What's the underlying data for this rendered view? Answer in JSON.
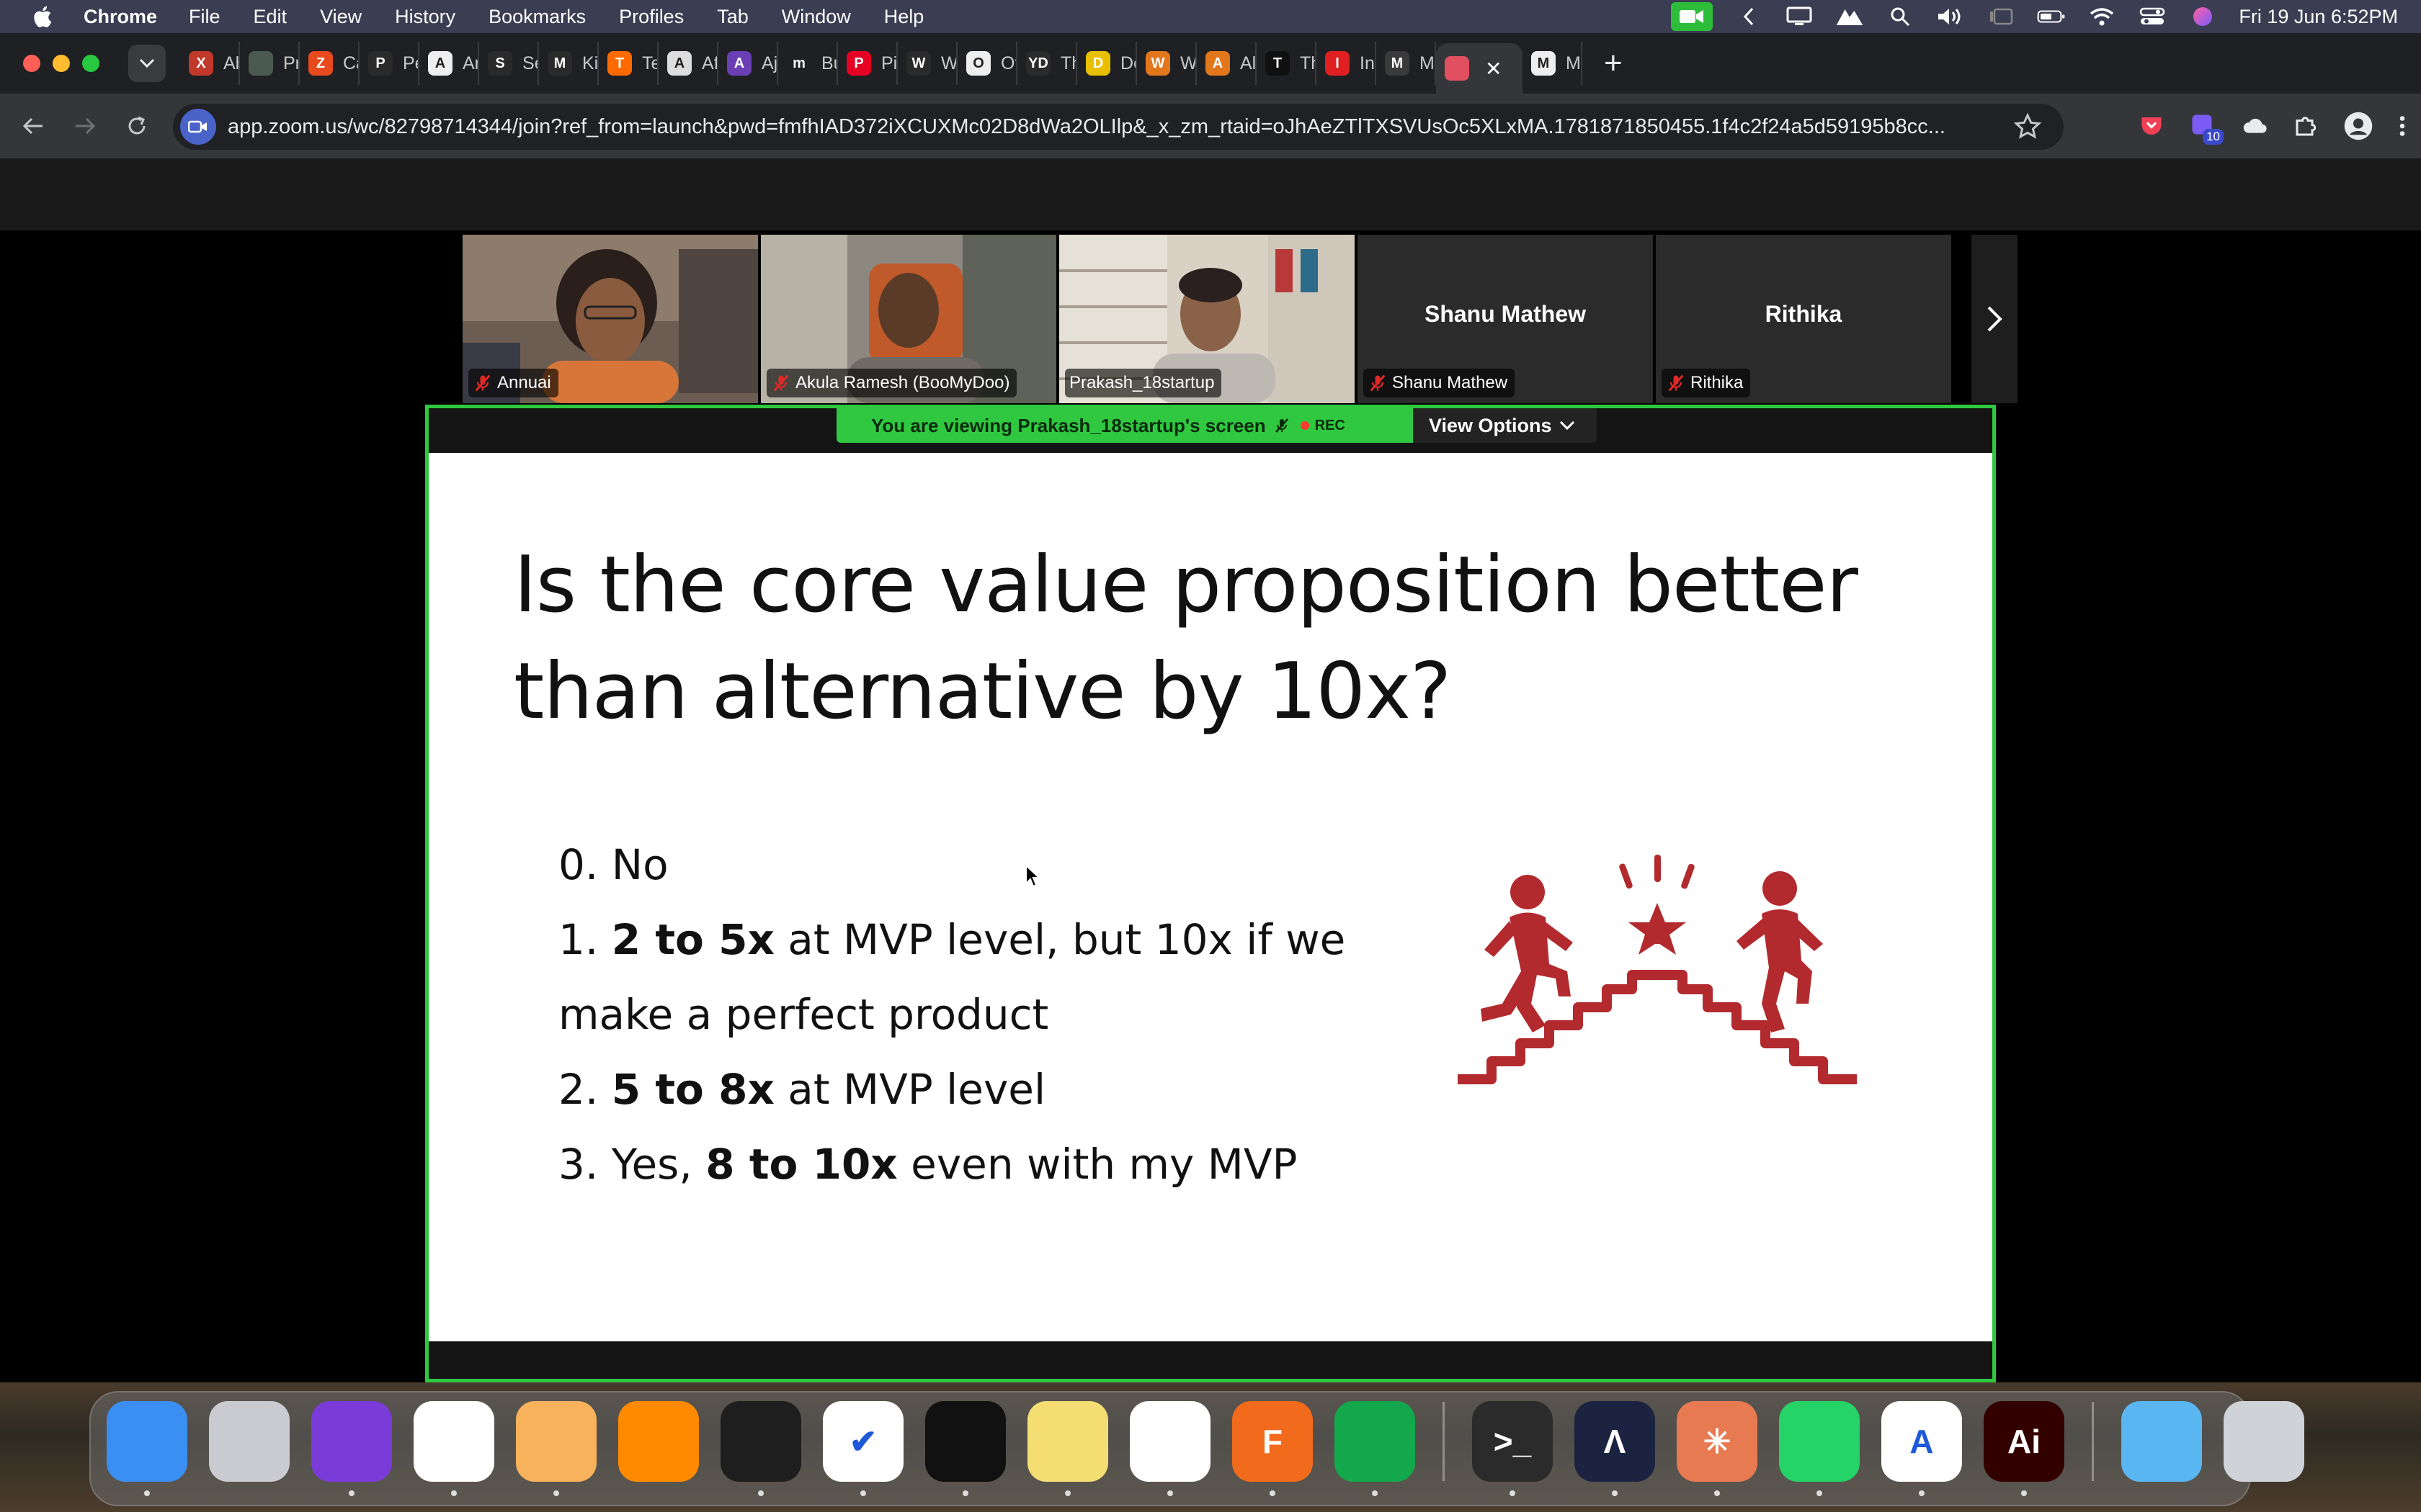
{
  "menubar": {
    "app_name": "Chrome",
    "items": [
      "File",
      "Edit",
      "View",
      "History",
      "Bookmarks",
      "Profiles",
      "Tab",
      "Window",
      "Help"
    ],
    "clock": "Fri 19 Jun  6:52PM"
  },
  "tabs": [
    {
      "label": "Ab",
      "color": "#c0392b",
      "glyph": "X"
    },
    {
      "label": "Pro",
      "color": "#4a5a50",
      "glyph": ""
    },
    {
      "label": "Cal",
      "color": "#e8491d",
      "glyph": "Z"
    },
    {
      "label": "Per",
      "color": "#2a2a2a",
      "glyph": "P"
    },
    {
      "label": "Arc",
      "color": "#eeeeee",
      "glyph": "A"
    },
    {
      "label": "Se",
      "color": "#2a2a2a",
      "glyph": "S"
    },
    {
      "label": "Kid",
      "color": "#2a2a2a",
      "glyph": "M"
    },
    {
      "label": "Ter",
      "color": "#ff6a00",
      "glyph": "T"
    },
    {
      "label": "Aff",
      "color": "#dddddd",
      "glyph": "A"
    },
    {
      "label": "Aja",
      "color": "#6a3fb5",
      "glyph": "A"
    },
    {
      "label": "Buy",
      "color": "#1f2023",
      "glyph": "m"
    },
    {
      "label": "Pin",
      "color": "#e60023",
      "glyph": "P"
    },
    {
      "label": "Wo",
      "color": "#2a2a2a",
      "glyph": "W"
    },
    {
      "label": "Off",
      "color": "#eeeeee",
      "glyph": "O"
    },
    {
      "label": "Thi",
      "color": "#2a2a2a",
      "glyph": "YD"
    },
    {
      "label": "De",
      "color": "#e8c000",
      "glyph": "D"
    },
    {
      "label": "Wo",
      "color": "#e2761b",
      "glyph": "W"
    },
    {
      "label": "All",
      "color": "#e2761b",
      "glyph": "A"
    },
    {
      "label": "The",
      "color": "#101010",
      "glyph": "T"
    },
    {
      "label": "In C",
      "color": "#e02020",
      "glyph": "I"
    },
    {
      "label": "Mo",
      "color": "#3a3a3a",
      "glyph": "M"
    },
    {
      "label": "",
      "color": "#e05060",
      "glyph": ""
    },
    {
      "label": "My",
      "color": "#eeeeee",
      "glyph": "M"
    }
  ],
  "address_bar": {
    "url": "app.zoom.us/wc/82798714344/join?ref_from=launch&pwd=fmfhIAD372iXCUXMc02D8dWa2OLIlp&_x_zm_rtaid=oJhAeZTlTXSVUsOc5XLxMA.1781871850455.1f4c2f24a5d59195b8cc..."
  },
  "toolbar": {
    "extension_badge": "10"
  },
  "participants": [
    {
      "name": "Annuai",
      "has_video": true,
      "muted": true,
      "speaking": false
    },
    {
      "name": "Akula Ramesh (BooMyDoo)",
      "has_video": true,
      "muted": true,
      "speaking": false
    },
    {
      "name": "Prakash_18startup",
      "has_video": true,
      "muted": false,
      "speaking": true
    },
    {
      "name": "Shanu Mathew",
      "has_video": false,
      "muted": true,
      "speaking": false
    },
    {
      "name": "Rithika",
      "has_video": false,
      "muted": true,
      "speaking": false
    }
  ],
  "share_banner": {
    "text": "You are viewing  Prakash_18startup's screen",
    "rec": "REC",
    "view_options": "View Options"
  },
  "slide": {
    "title": "Is the core value proposition better than alternative by 10x?",
    "options": [
      {
        "prefix": "0. ",
        "bold": "",
        "rest": "No"
      },
      {
        "prefix": "1. ",
        "bold": "2 to 5x",
        "rest": " at MVP level, but 10x if we make a perfect product"
      },
      {
        "prefix": "2. ",
        "bold": "5 to 8x",
        "rest": " at MVP level"
      },
      {
        "prefix": "3. Yes, ",
        "bold": "8 to 10x",
        "rest": " even with my MVP"
      }
    ],
    "illustration": "people-climbing-stairs-to-star-icon",
    "accent_color": "#b22a2e"
  },
  "dock": [
    {
      "name": "finder",
      "color": "#3b8ff2",
      "glyph": ""
    },
    {
      "name": "launchpad",
      "color": "#c9cbd0",
      "glyph": ""
    },
    {
      "name": "firefox",
      "color": "#7b3bd9",
      "glyph": ""
    },
    {
      "name": "chrome",
      "color": "#ffffff",
      "glyph": ""
    },
    {
      "name": "arc-or-weather",
      "color": "#f7b25b",
      "glyph": ""
    },
    {
      "name": "books",
      "color": "#ff8a00",
      "glyph": ""
    },
    {
      "name": "figma",
      "color": "#1e1e1e",
      "glyph": ""
    },
    {
      "name": "tasks",
      "color": "#ffffff",
      "glyph": "✔"
    },
    {
      "name": "notion-like",
      "color": "#111111",
      "glyph": ""
    },
    {
      "name": "stickies",
      "color": "#f4de74",
      "glyph": ""
    },
    {
      "name": "vscode",
      "color": "#ffffff",
      "glyph": ""
    },
    {
      "name": "fusion",
      "color": "#f26a1b",
      "glyph": "F"
    },
    {
      "name": "numbers",
      "color": "#13a84b",
      "glyph": ""
    },
    {
      "name": "terminal",
      "color": "#2b2b2b",
      "glyph": ">_"
    },
    {
      "name": "vectornator",
      "color": "#1c2340",
      "glyph": "Λ"
    },
    {
      "name": "claude",
      "color": "#e87a52",
      "glyph": "✳"
    },
    {
      "name": "whatsapp",
      "color": "#25d366",
      "glyph": ""
    },
    {
      "name": "xcode-instruments",
      "color": "#ffffff",
      "glyph": "A"
    },
    {
      "name": "illustrator",
      "color": "#330000",
      "glyph": "Ai"
    },
    {
      "name": "folder",
      "color": "#59b6f0",
      "glyph": ""
    },
    {
      "name": "trash",
      "color": "#cfd2d6",
      "glyph": ""
    }
  ]
}
